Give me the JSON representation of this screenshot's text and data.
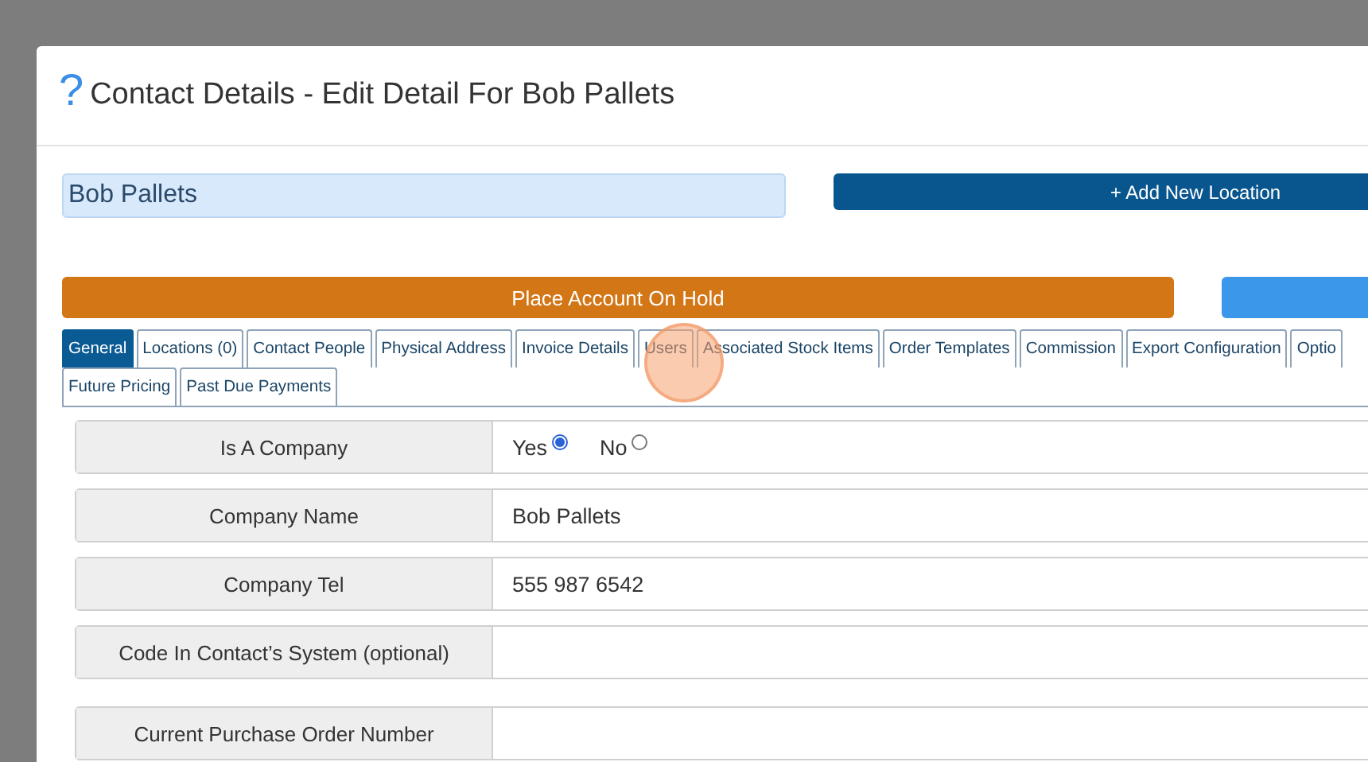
{
  "dialog": {
    "icon": "?",
    "title": "Contact Details - Edit Detail For Bob Pallets"
  },
  "name_field": {
    "value": "Bob Pallets"
  },
  "add_location_button": {
    "label": "+ Add New Location"
  },
  "hold_button": {
    "label": "Place Account On Hold"
  },
  "tabs": [
    {
      "label": "General",
      "selected": true
    },
    {
      "label": "Locations (0)",
      "selected": false
    },
    {
      "label": "Contact People",
      "selected": false
    },
    {
      "label": "Physical Address",
      "selected": false
    },
    {
      "label": "Invoice Details",
      "selected": false
    },
    {
      "label": "Users",
      "selected": false
    },
    {
      "label": "Associated Stock Items",
      "selected": false
    },
    {
      "label": "Order Templates",
      "selected": false
    },
    {
      "label": "Commission",
      "selected": false
    },
    {
      "label": "Export Configuration",
      "selected": false
    },
    {
      "label": "Optio",
      "selected": false
    },
    {
      "label": "Future Pricing",
      "selected": false
    },
    {
      "label": "Past Due Payments",
      "selected": false
    }
  ],
  "form_rows": [
    {
      "kind": "radio",
      "label": "Is A Company",
      "options": [
        {
          "label": "Yes",
          "selected": true
        },
        {
          "label": "No",
          "selected": false
        }
      ]
    },
    {
      "kind": "text",
      "label": "Company Name",
      "value": "Bob Pallets"
    },
    {
      "kind": "text",
      "label": "Company Tel",
      "value": "555 987 6542"
    },
    {
      "kind": "text",
      "label": "Code In Contact’s System (optional)",
      "value": ""
    },
    {
      "kind": "text",
      "label": "Current Purchase Order Number",
      "value": ""
    }
  ]
}
